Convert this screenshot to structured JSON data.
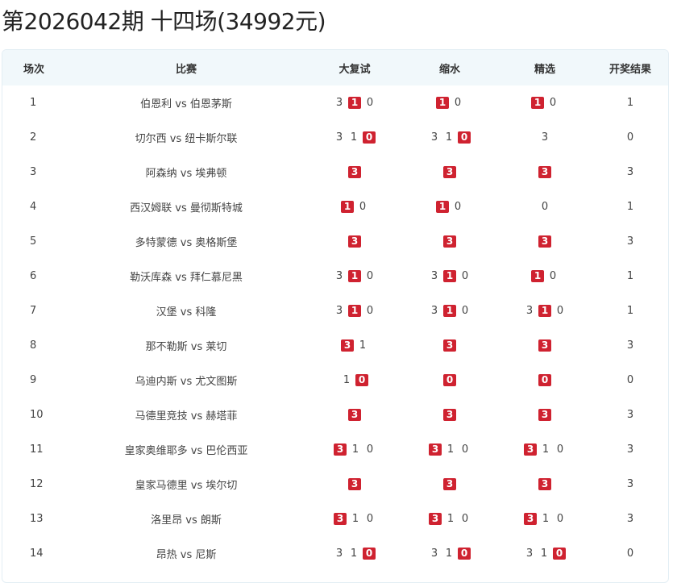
{
  "title": "第2026042期 十四场(34992元)",
  "columns": {
    "idx": "场次",
    "match": "比赛",
    "full": "大复试",
    "reduced": "缩水",
    "selected": "精选",
    "result": "开奖结果"
  },
  "accent_color": "#cf2230",
  "rows": [
    {
      "idx": "1",
      "match": "伯恩利 vs 伯恩茅斯",
      "full": [
        [
          "3",
          false
        ],
        [
          "1",
          true
        ],
        [
          "0",
          false
        ]
      ],
      "reduced": [
        [
          "1",
          true
        ],
        [
          "0",
          false
        ]
      ],
      "selected": [
        [
          "1",
          true
        ],
        [
          "0",
          false
        ]
      ],
      "result": "1"
    },
    {
      "idx": "2",
      "match": "切尔西 vs 纽卡斯尔联",
      "full": [
        [
          "3",
          false
        ],
        [
          "1",
          false
        ],
        [
          "0",
          true
        ]
      ],
      "reduced": [
        [
          "3",
          false
        ],
        [
          "1",
          false
        ],
        [
          "0",
          true
        ]
      ],
      "selected": [
        [
          "3",
          false
        ]
      ],
      "result": "0"
    },
    {
      "idx": "3",
      "match": "阿森纳 vs 埃弗顿",
      "full": [
        [
          "3",
          true
        ]
      ],
      "reduced": [
        [
          "3",
          true
        ]
      ],
      "selected": [
        [
          "3",
          true
        ]
      ],
      "result": "3"
    },
    {
      "idx": "4",
      "match": "西汉姆联 vs 曼彻斯特城",
      "full": [
        [
          "1",
          true
        ],
        [
          "0",
          false
        ]
      ],
      "reduced": [
        [
          "1",
          true
        ],
        [
          "0",
          false
        ]
      ],
      "selected": [
        [
          "0",
          false
        ]
      ],
      "result": "1"
    },
    {
      "idx": "5",
      "match": "多特蒙德 vs 奥格斯堡",
      "full": [
        [
          "3",
          true
        ]
      ],
      "reduced": [
        [
          "3",
          true
        ]
      ],
      "selected": [
        [
          "3",
          true
        ]
      ],
      "result": "3"
    },
    {
      "idx": "6",
      "match": "勒沃库森 vs 拜仁慕尼黑",
      "full": [
        [
          "3",
          false
        ],
        [
          "1",
          true
        ],
        [
          "0",
          false
        ]
      ],
      "reduced": [
        [
          "3",
          false
        ],
        [
          "1",
          true
        ],
        [
          "0",
          false
        ]
      ],
      "selected": [
        [
          "1",
          true
        ],
        [
          "0",
          false
        ]
      ],
      "result": "1"
    },
    {
      "idx": "7",
      "match": "汉堡 vs 科隆",
      "full": [
        [
          "3",
          false
        ],
        [
          "1",
          true
        ],
        [
          "0",
          false
        ]
      ],
      "reduced": [
        [
          "3",
          false
        ],
        [
          "1",
          true
        ],
        [
          "0",
          false
        ]
      ],
      "selected": [
        [
          "3",
          false
        ],
        [
          "1",
          true
        ],
        [
          "0",
          false
        ]
      ],
      "result": "1"
    },
    {
      "idx": "8",
      "match": "那不勒斯 vs 莱切",
      "full": [
        [
          "3",
          true
        ],
        [
          "1",
          false
        ]
      ],
      "reduced": [
        [
          "3",
          true
        ]
      ],
      "selected": [
        [
          "3",
          true
        ]
      ],
      "result": "3"
    },
    {
      "idx": "9",
      "match": "乌迪内斯 vs 尤文图斯",
      "full": [
        [
          "1",
          false
        ],
        [
          "0",
          true
        ]
      ],
      "reduced": [
        [
          "0",
          true
        ]
      ],
      "selected": [
        [
          "0",
          true
        ]
      ],
      "result": "0"
    },
    {
      "idx": "10",
      "match": "马德里竞技 vs 赫塔菲",
      "full": [
        [
          "3",
          true
        ]
      ],
      "reduced": [
        [
          "3",
          true
        ]
      ],
      "selected": [
        [
          "3",
          true
        ]
      ],
      "result": "3"
    },
    {
      "idx": "11",
      "match": "皇家奥维耶多 vs 巴伦西亚",
      "full": [
        [
          "3",
          true
        ],
        [
          "1",
          false
        ],
        [
          "0",
          false
        ]
      ],
      "reduced": [
        [
          "3",
          true
        ],
        [
          "1",
          false
        ],
        [
          "0",
          false
        ]
      ],
      "selected": [
        [
          "3",
          true
        ],
        [
          "1",
          false
        ],
        [
          "0",
          false
        ]
      ],
      "result": "3"
    },
    {
      "idx": "12",
      "match": "皇家马德里 vs 埃尔切",
      "full": [
        [
          "3",
          true
        ]
      ],
      "reduced": [
        [
          "3",
          true
        ]
      ],
      "selected": [
        [
          "3",
          true
        ]
      ],
      "result": "3"
    },
    {
      "idx": "13",
      "match": "洛里昂 vs 朗斯",
      "full": [
        [
          "3",
          true
        ],
        [
          "1",
          false
        ],
        [
          "0",
          false
        ]
      ],
      "reduced": [
        [
          "3",
          true
        ],
        [
          "1",
          false
        ],
        [
          "0",
          false
        ]
      ],
      "selected": [
        [
          "3",
          true
        ],
        [
          "1",
          false
        ],
        [
          "0",
          false
        ]
      ],
      "result": "3"
    },
    {
      "idx": "14",
      "match": "昂热 vs 尼斯",
      "full": [
        [
          "3",
          false
        ],
        [
          "1",
          false
        ],
        [
          "0",
          true
        ]
      ],
      "reduced": [
        [
          "3",
          false
        ],
        [
          "1",
          false
        ],
        [
          "0",
          true
        ]
      ],
      "selected": [
        [
          "3",
          false
        ],
        [
          "1",
          false
        ],
        [
          "0",
          true
        ]
      ],
      "result": "0"
    }
  ]
}
